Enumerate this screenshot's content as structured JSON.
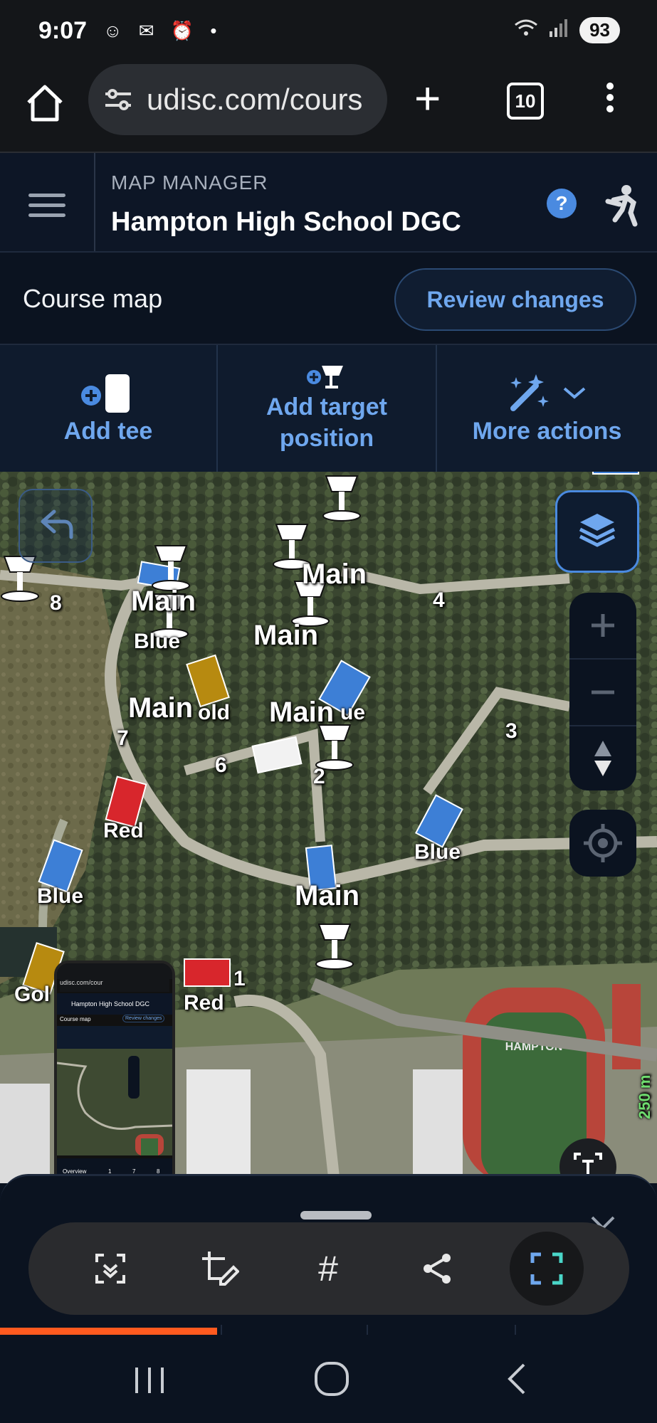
{
  "status_bar": {
    "time": "9:07",
    "battery": "93",
    "icons_left": [
      "notification-icon",
      "mail-icon",
      "alarm-icon",
      "dot-icon"
    ],
    "icons_right": [
      "wifi-icon",
      "signal-icon",
      "battery-icon"
    ]
  },
  "browser": {
    "url": "udisc.com/cours",
    "tab_count": "10",
    "icons": [
      "home-icon",
      "site-settings-icon",
      "new-tab-icon",
      "tabs-icon",
      "more-icon"
    ]
  },
  "header": {
    "eyebrow": "MAP MANAGER",
    "title": "Hampton High School DGC",
    "help_glyph": "?"
  },
  "course_bar": {
    "title": "Course map",
    "review_button": "Review changes"
  },
  "actions": [
    {
      "label": "Add tee",
      "icon": "add-tee-icon"
    },
    {
      "label_line1": "Add target",
      "label_line2": "position",
      "icon": "add-target-icon"
    },
    {
      "label": "More actions",
      "icon": "magic-wand-icon"
    }
  ],
  "map": {
    "labels_main": [
      "Main",
      "Main",
      "Main",
      "Main",
      "Main",
      "Main"
    ],
    "tee_labels": [
      "Blue",
      "Red",
      "Blue",
      "Blue",
      "Red",
      "Gol",
      "Blue",
      "old",
      "ue"
    ],
    "hole_numbers": [
      "1",
      "2",
      "3",
      "4",
      "6",
      "7",
      "8"
    ],
    "stadium_text": "HAMPTON",
    "scale_text": "250 m",
    "colors": {
      "blue_tee": "#3d7fd6",
      "red_tee": "#d8262c",
      "gold_tee": "#b78a10",
      "white_tee": "#f2f2f2",
      "track": "#b8453a",
      "field": "#3c6a3a"
    }
  },
  "mini_screenshot": {
    "url": "udisc.com/cour",
    "title": "Hampton High School DGC",
    "course_map": "Course map",
    "review": "Review changes",
    "tab_overview": "Overview",
    "tabs": [
      "1",
      "7",
      "8"
    ]
  },
  "toolbar": {
    "tools": [
      "scan-icon",
      "edit-crop-icon",
      "hashtag-icon",
      "share-icon",
      "capture-icon"
    ]
  },
  "progress": 0.33
}
